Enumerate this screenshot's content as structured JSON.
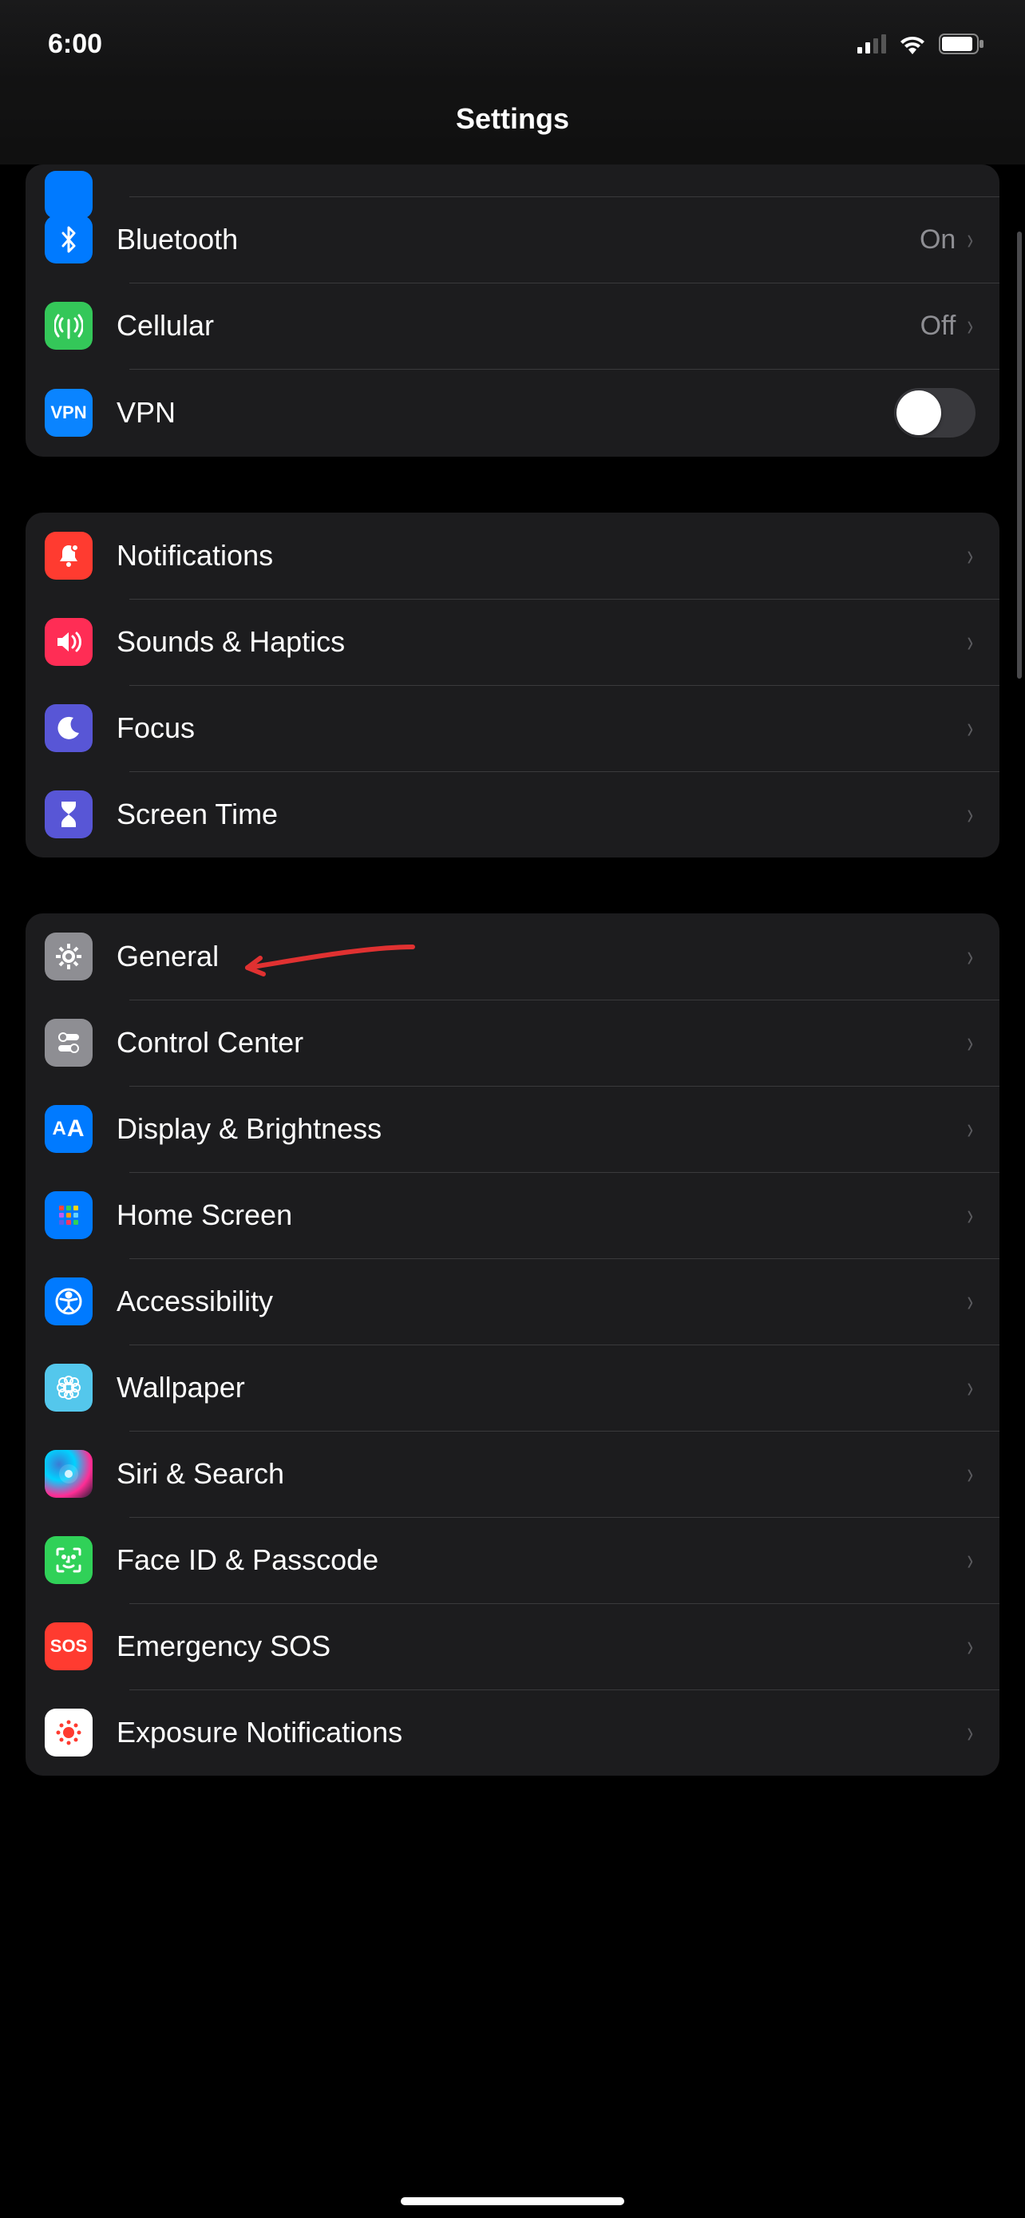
{
  "status": {
    "time": "6:00"
  },
  "title": "Settings",
  "groups": {
    "connectivity": [
      {
        "id": "bluetooth",
        "label": "Bluetooth",
        "value": "On",
        "type": "link"
      },
      {
        "id": "cellular",
        "label": "Cellular",
        "value": "Off",
        "type": "link"
      },
      {
        "id": "vpn",
        "label": "VPN",
        "toggle": false,
        "type": "toggle"
      }
    ],
    "attention": [
      {
        "id": "notifications",
        "label": "Notifications"
      },
      {
        "id": "sounds",
        "label": "Sounds & Haptics"
      },
      {
        "id": "focus",
        "label": "Focus"
      },
      {
        "id": "screentime",
        "label": "Screen Time"
      }
    ],
    "system": [
      {
        "id": "general",
        "label": "General"
      },
      {
        "id": "controlcenter",
        "label": "Control Center"
      },
      {
        "id": "display",
        "label": "Display & Brightness"
      },
      {
        "id": "homescreen",
        "label": "Home Screen"
      },
      {
        "id": "accessibility",
        "label": "Accessibility"
      },
      {
        "id": "wallpaper",
        "label": "Wallpaper"
      },
      {
        "id": "siri",
        "label": "Siri & Search"
      },
      {
        "id": "faceid",
        "label": "Face ID & Passcode"
      },
      {
        "id": "sos",
        "label": "Emergency SOS"
      },
      {
        "id": "exposure",
        "label": "Exposure Notifications"
      }
    ]
  },
  "annotation": {
    "target": "general"
  }
}
